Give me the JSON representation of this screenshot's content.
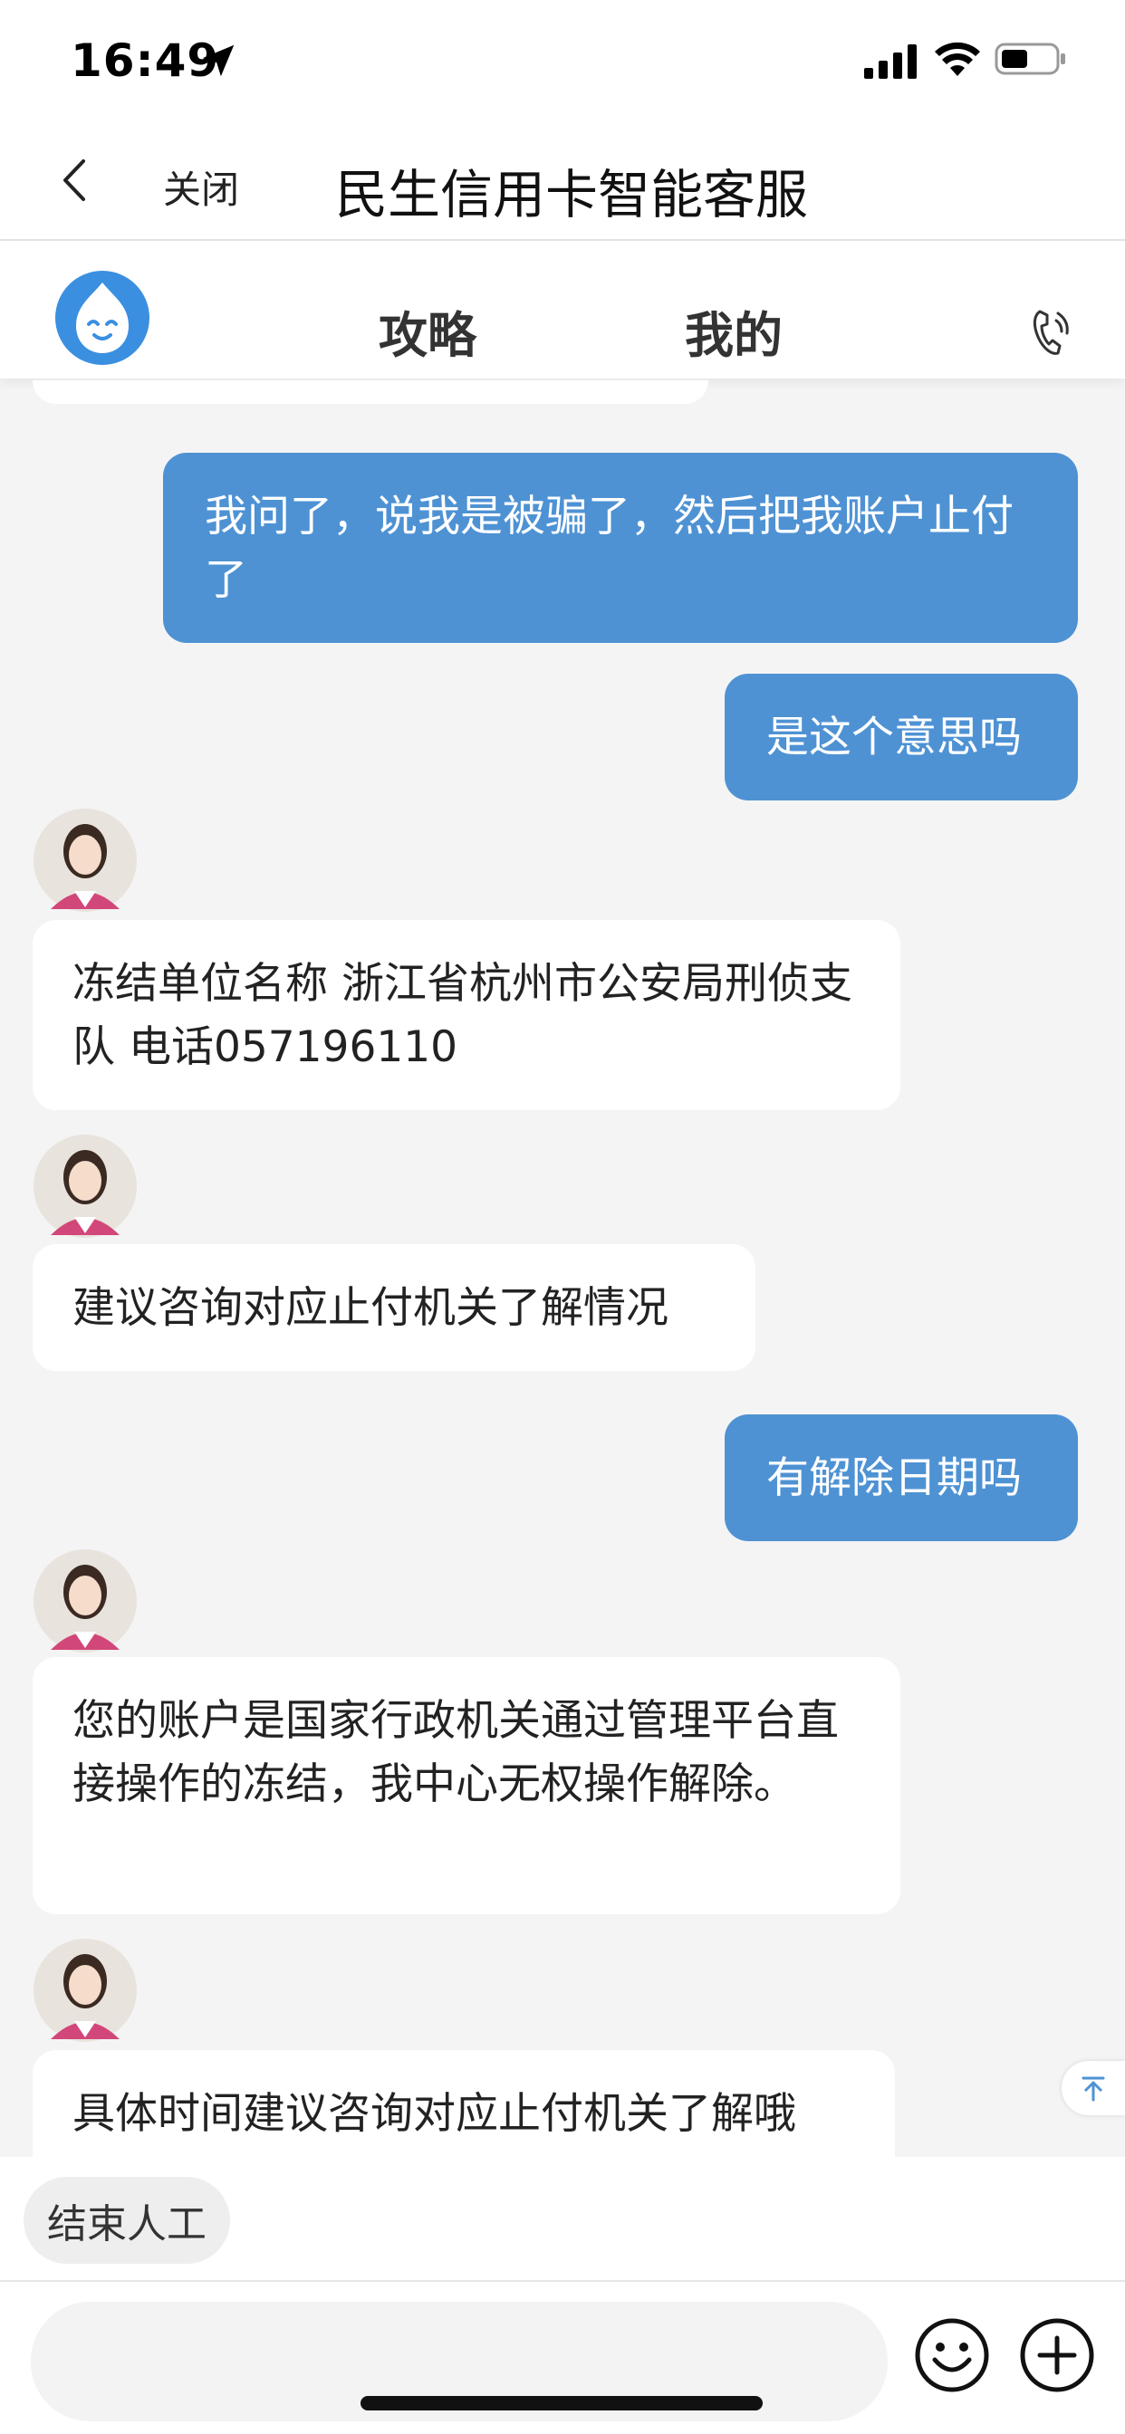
{
  "status_bar": {
    "time": "16:49"
  },
  "nav": {
    "close_label": "关闭",
    "title": "民生信用卡智能客服"
  },
  "tabs": [
    {
      "label": "攻略"
    },
    {
      "label": "我的"
    }
  ],
  "messages": [
    {
      "from": "user",
      "text": "我问了，说我是被骗了，然后把我账户止付了"
    },
    {
      "from": "user",
      "text": "是这个意思吗"
    },
    {
      "from": "agent",
      "text": "冻结单位名称 浙江省杭州市公安局刑侦支队 电话057196110"
    },
    {
      "from": "agent",
      "text": "建议咨询对应止付机关了解情况"
    },
    {
      "from": "user",
      "text": "有解除日期吗"
    },
    {
      "from": "agent",
      "text": "您的账户是国家行政机关通过管理平台直接操作的冻结，我中心无权操作解除。"
    },
    {
      "from": "agent",
      "text": "具体时间建议咨询对应止付机关了解哦"
    }
  ],
  "bottom": {
    "end_human_label": "结束人工"
  },
  "colors": {
    "user_bubble": "#4e92d4",
    "agent_bubble": "#ffffff",
    "background": "#f4f4f4"
  },
  "icons": [
    "location-arrow-icon",
    "signal-icon",
    "wifi-icon",
    "battery-icon",
    "back-chevron-icon",
    "bot-avatar-icon",
    "phone-icon",
    "agent-avatar-icon",
    "emoji-icon",
    "plus-icon",
    "scroll-top-icon"
  ]
}
